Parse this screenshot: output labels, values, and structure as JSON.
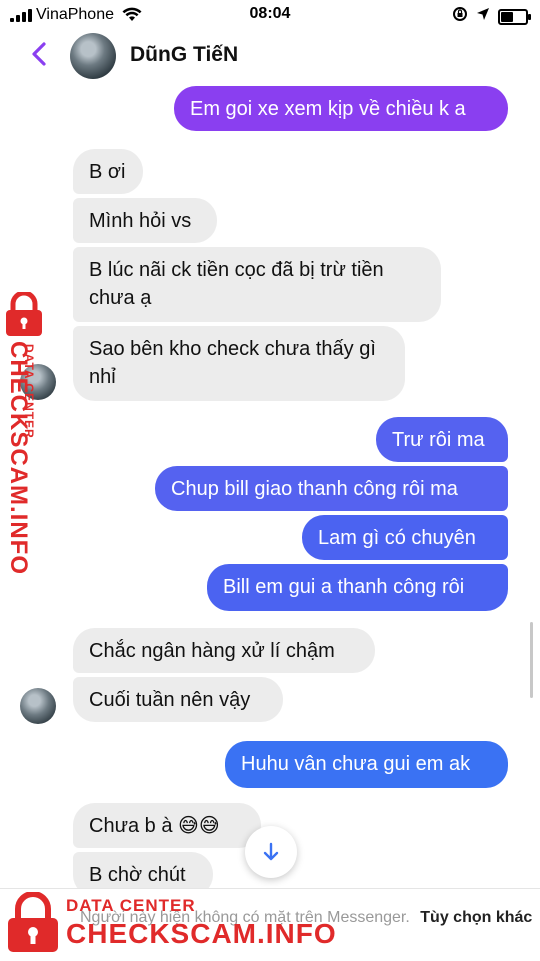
{
  "status_bar": {
    "carrier": "VinaPhone",
    "time": "08:04",
    "battery_level": 0.55
  },
  "header": {
    "contact_name": "DũnG TiếN"
  },
  "messages": [
    {
      "dir": "out",
      "text": "Em goi xe xem kịp về chiều k a"
    },
    {
      "dir": "in",
      "text": "B ơi"
    },
    {
      "dir": "in",
      "text": "Mình hỏi vs"
    },
    {
      "dir": "in",
      "text": "B lúc nãi ck tiền cọc đã bị trừ tiền chưa ạ"
    },
    {
      "dir": "in",
      "text": "Sao bên kho check chưa thấy gì nhỉ"
    },
    {
      "dir": "out",
      "text": "Trư rôi ma"
    },
    {
      "dir": "out",
      "text": "Chup bill giao thanh công rôi ma"
    },
    {
      "dir": "out",
      "text": "Lam gì có chuyên"
    },
    {
      "dir": "out",
      "text": "Bill em gui a thanh công rôi"
    },
    {
      "dir": "in",
      "text": "Chắc ngân hàng xử lí chậm"
    },
    {
      "dir": "in",
      "text": "Cuối tuần nên vậy"
    },
    {
      "dir": "out",
      "text": "Huhu vân chưa gui em ak"
    },
    {
      "dir": "in",
      "text": "Chưa b à 😅😅"
    },
    {
      "dir": "in",
      "text": "B chờ chút"
    }
  ],
  "footer": {
    "notice_text": "Người này hiện không có mặt trên Messenger.",
    "notice_link": "Tùy chọn khác"
  },
  "watermark": {
    "brand": "CHECKSCAM.INFO",
    "subtitle": "DATA CENTER"
  },
  "colors": {
    "accent": "#8a3ff0",
    "outgoing_blue": "#3a72f3",
    "incoming_bg": "#ececec",
    "watermark_red": "#e02a2a"
  }
}
